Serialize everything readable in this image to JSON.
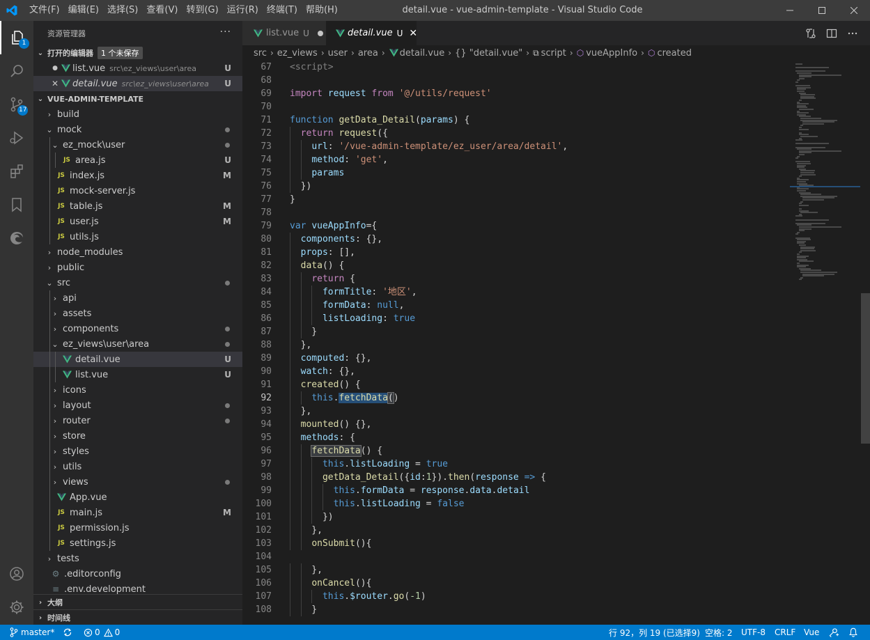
{
  "titlebar": {
    "menus": [
      "文件(F)",
      "编辑(E)",
      "选择(S)",
      "查看(V)",
      "转到(G)",
      "运行(R)",
      "终端(T)",
      "帮助(H)"
    ],
    "title": "detail.vue - vue-admin-template - Visual Studio Code"
  },
  "activity": {
    "explorer_badge": "1",
    "scm_badge": "17"
  },
  "sidebar": {
    "title": "资源管理器",
    "more": "···",
    "open_editors": {
      "label": "打开的编辑器",
      "unsaved_label": "1 个未保存",
      "items": [
        {
          "name": "list.vue",
          "path": "src\\ez_views\\user\\area",
          "status": "U"
        },
        {
          "name": "detail.vue",
          "path": "src\\ez_views\\user\\area",
          "status": "U"
        }
      ]
    },
    "project": {
      "label": "VUE-ADMIN-TEMPLATE",
      "tree": [
        {
          "name": "build",
          "kind": "folder",
          "depth": 0,
          "open": false,
          "status": ""
        },
        {
          "name": "mock",
          "kind": "folder",
          "depth": 0,
          "open": true,
          "status": "dot"
        },
        {
          "name": "ez_mock\\user",
          "kind": "folder",
          "depth": 1,
          "open": true,
          "status": "dot"
        },
        {
          "name": "area.js",
          "kind": "js",
          "depth": 2,
          "status": "U"
        },
        {
          "name": "index.js",
          "kind": "js",
          "depth": 1,
          "status": "M"
        },
        {
          "name": "mock-server.js",
          "kind": "js",
          "depth": 1,
          "status": ""
        },
        {
          "name": "table.js",
          "kind": "js",
          "depth": 1,
          "status": "M"
        },
        {
          "name": "user.js",
          "kind": "js",
          "depth": 1,
          "status": "M"
        },
        {
          "name": "utils.js",
          "kind": "js",
          "depth": 1,
          "status": ""
        },
        {
          "name": "node_modules",
          "kind": "folder",
          "depth": 0,
          "open": false,
          "status": ""
        },
        {
          "name": "public",
          "kind": "folder",
          "depth": 0,
          "open": false,
          "status": ""
        },
        {
          "name": "src",
          "kind": "folder",
          "depth": 0,
          "open": true,
          "status": "dot"
        },
        {
          "name": "api",
          "kind": "folder",
          "depth": 1,
          "open": false,
          "status": ""
        },
        {
          "name": "assets",
          "kind": "folder",
          "depth": 1,
          "open": false,
          "status": ""
        },
        {
          "name": "components",
          "kind": "folder",
          "depth": 1,
          "open": false,
          "status": "dot"
        },
        {
          "name": "ez_views\\user\\area",
          "kind": "folder",
          "depth": 1,
          "open": true,
          "status": "dot"
        },
        {
          "name": "detail.vue",
          "kind": "vue",
          "depth": 2,
          "status": "U",
          "selected": true
        },
        {
          "name": "list.vue",
          "kind": "vue",
          "depth": 2,
          "status": "U"
        },
        {
          "name": "icons",
          "kind": "folder",
          "depth": 1,
          "open": false,
          "status": ""
        },
        {
          "name": "layout",
          "kind": "folder",
          "depth": 1,
          "open": false,
          "status": "dot"
        },
        {
          "name": "router",
          "kind": "folder",
          "depth": 1,
          "open": false,
          "status": "dot"
        },
        {
          "name": "store",
          "kind": "folder",
          "depth": 1,
          "open": false,
          "status": ""
        },
        {
          "name": "styles",
          "kind": "folder",
          "depth": 1,
          "open": false,
          "status": ""
        },
        {
          "name": "utils",
          "kind": "folder",
          "depth": 1,
          "open": false,
          "status": ""
        },
        {
          "name": "views",
          "kind": "folder",
          "depth": 1,
          "open": false,
          "status": "dot"
        },
        {
          "name": "App.vue",
          "kind": "vue",
          "depth": 1,
          "status": ""
        },
        {
          "name": "main.js",
          "kind": "js",
          "depth": 1,
          "status": "M"
        },
        {
          "name": "permission.js",
          "kind": "js",
          "depth": 1,
          "status": ""
        },
        {
          "name": "settings.js",
          "kind": "js",
          "depth": 1,
          "status": ""
        },
        {
          "name": "tests",
          "kind": "folder",
          "depth": 0,
          "open": false,
          "status": ""
        },
        {
          "name": ".editorconfig",
          "kind": "cfg",
          "depth": 0,
          "status": ""
        },
        {
          "name": ".env.development",
          "kind": "txt",
          "depth": 0,
          "status": ""
        }
      ]
    },
    "outline_label": "大纲",
    "timeline_label": "时间线"
  },
  "tabs": [
    {
      "name": "list.vue",
      "status": "U",
      "active": false,
      "dirty": true
    },
    {
      "name": "detail.vue",
      "status": "U",
      "active": true,
      "dirty": false
    }
  ],
  "breadcrumb": [
    "src",
    "ez_views",
    "user",
    "area",
    "detail.vue",
    "{} \"detail.vue\"",
    "script",
    "vueAppInfo",
    "created"
  ],
  "code": {
    "lines": [
      {
        "n": "67",
        "t": [
          [
            "t",
            "<script>"
          ]
        ]
      },
      {
        "n": "68",
        "t": []
      },
      {
        "n": "69",
        "t": [
          [
            "kc",
            "import"
          ],
          [
            "d",
            " "
          ],
          [
            "p",
            "request"
          ],
          [
            "d",
            " "
          ],
          [
            "kc",
            "from"
          ],
          [
            "d",
            " "
          ],
          [
            "s",
            "'@/utils/request'"
          ]
        ]
      },
      {
        "n": "70",
        "t": []
      },
      {
        "n": "71",
        "t": [
          [
            "k",
            "function"
          ],
          [
            "d",
            " "
          ],
          [
            "f",
            "getData_Detail"
          ],
          [
            "d",
            "("
          ],
          [
            "p",
            "params"
          ],
          [
            "d",
            ") {"
          ]
        ]
      },
      {
        "n": "72",
        "t": [
          [
            "d",
            "  "
          ],
          [
            "kc",
            "return"
          ],
          [
            "d",
            " "
          ],
          [
            "f",
            "request"
          ],
          [
            "d",
            "({"
          ]
        ]
      },
      {
        "n": "73",
        "t": [
          [
            "d",
            "    "
          ],
          [
            "p",
            "url"
          ],
          [
            "d",
            ": "
          ],
          [
            "s",
            "'/vue-admin-template/ez_user/area/detail'"
          ],
          [
            "d",
            ","
          ]
        ]
      },
      {
        "n": "74",
        "t": [
          [
            "d",
            "    "
          ],
          [
            "p",
            "method"
          ],
          [
            "d",
            ": "
          ],
          [
            "s",
            "'get'"
          ],
          [
            "d",
            ","
          ]
        ]
      },
      {
        "n": "75",
        "t": [
          [
            "d",
            "    "
          ],
          [
            "p",
            "params"
          ]
        ]
      },
      {
        "n": "76",
        "t": [
          [
            "d",
            "  })"
          ]
        ]
      },
      {
        "n": "77",
        "t": [
          [
            "d",
            "}"
          ]
        ]
      },
      {
        "n": "78",
        "t": []
      },
      {
        "n": "79",
        "t": [
          [
            "k",
            "var"
          ],
          [
            "d",
            " "
          ],
          [
            "p",
            "vueAppInfo"
          ],
          [
            "d",
            "={"
          ]
        ]
      },
      {
        "n": "80",
        "t": [
          [
            "d",
            "  "
          ],
          [
            "p",
            "components"
          ],
          [
            "d",
            ": {},"
          ]
        ]
      },
      {
        "n": "81",
        "t": [
          [
            "d",
            "  "
          ],
          [
            "p",
            "props"
          ],
          [
            "d",
            ": [],"
          ]
        ]
      },
      {
        "n": "82",
        "t": [
          [
            "d",
            "  "
          ],
          [
            "f",
            "data"
          ],
          [
            "d",
            "() {"
          ]
        ]
      },
      {
        "n": "83",
        "t": [
          [
            "d",
            "    "
          ],
          [
            "kc",
            "return"
          ],
          [
            "d",
            " {"
          ]
        ]
      },
      {
        "n": "84",
        "t": [
          [
            "d",
            "      "
          ],
          [
            "p",
            "formTitle"
          ],
          [
            "d",
            ": "
          ],
          [
            "s",
            "'地区'"
          ],
          [
            "d",
            ","
          ]
        ]
      },
      {
        "n": "85",
        "t": [
          [
            "d",
            "      "
          ],
          [
            "p",
            "formData"
          ],
          [
            "d",
            ": "
          ],
          [
            "k",
            "null"
          ],
          [
            "d",
            ","
          ]
        ]
      },
      {
        "n": "86",
        "t": [
          [
            "d",
            "      "
          ],
          [
            "p",
            "listLoading"
          ],
          [
            "d",
            ": "
          ],
          [
            "k",
            "true"
          ]
        ]
      },
      {
        "n": "87",
        "t": [
          [
            "d",
            "    }"
          ]
        ]
      },
      {
        "n": "88",
        "t": [
          [
            "d",
            "  },"
          ]
        ]
      },
      {
        "n": "89",
        "t": [
          [
            "d",
            "  "
          ],
          [
            "p",
            "computed"
          ],
          [
            "d",
            ": {},"
          ]
        ]
      },
      {
        "n": "90",
        "t": [
          [
            "d",
            "  "
          ],
          [
            "p",
            "watch"
          ],
          [
            "d",
            ": {},"
          ]
        ]
      },
      {
        "n": "91",
        "t": [
          [
            "d",
            "  "
          ],
          [
            "f",
            "created"
          ],
          [
            "d",
            "() {"
          ]
        ]
      },
      {
        "n": "92",
        "t": [
          [
            "d",
            "    "
          ],
          [
            "k",
            "this"
          ],
          [
            "d",
            "."
          ],
          [
            "fh",
            "fetchData"
          ],
          [
            "cur",
            ""
          ],
          [
            "bm",
            "("
          ],
          [
            "d",
            ")"
          ]
        ],
        "current": true
      },
      {
        "n": "93",
        "t": [
          [
            "d",
            "  },"
          ]
        ]
      },
      {
        "n": "94",
        "t": [
          [
            "d",
            "  "
          ],
          [
            "f",
            "mounted"
          ],
          [
            "d",
            "() {},"
          ]
        ]
      },
      {
        "n": "95",
        "t": [
          [
            "d",
            "  "
          ],
          [
            "p",
            "methods"
          ],
          [
            "d",
            ": {"
          ]
        ]
      },
      {
        "n": "96",
        "t": [
          [
            "d",
            "    "
          ],
          [
            "fm",
            "fetchData"
          ],
          [
            "d",
            "() {"
          ]
        ]
      },
      {
        "n": "97",
        "t": [
          [
            "d",
            "      "
          ],
          [
            "k",
            "this"
          ],
          [
            "d",
            "."
          ],
          [
            "p",
            "listLoading"
          ],
          [
            "d",
            " = "
          ],
          [
            "k",
            "true"
          ]
        ]
      },
      {
        "n": "98",
        "t": [
          [
            "d",
            "      "
          ],
          [
            "f",
            "getData_Detail"
          ],
          [
            "d",
            "({"
          ],
          [
            "p",
            "id"
          ],
          [
            "d",
            ":"
          ],
          [
            "num",
            "1"
          ],
          [
            "d",
            "})."
          ],
          [
            "f",
            "then"
          ],
          [
            "d",
            "("
          ],
          [
            "p",
            "response"
          ],
          [
            "d",
            " "
          ],
          [
            "k",
            "=>"
          ],
          [
            "d",
            " {"
          ]
        ]
      },
      {
        "n": "99",
        "t": [
          [
            "d",
            "        "
          ],
          [
            "k",
            "this"
          ],
          [
            "d",
            "."
          ],
          [
            "p",
            "formData"
          ],
          [
            "d",
            " = "
          ],
          [
            "p",
            "response"
          ],
          [
            "d",
            "."
          ],
          [
            "p",
            "data"
          ],
          [
            "d",
            "."
          ],
          [
            "p",
            "detail"
          ]
        ]
      },
      {
        "n": "100",
        "t": [
          [
            "d",
            "        "
          ],
          [
            "k",
            "this"
          ],
          [
            "d",
            "."
          ],
          [
            "p",
            "listLoading"
          ],
          [
            "d",
            " = "
          ],
          [
            "k",
            "false"
          ]
        ]
      },
      {
        "n": "101",
        "t": [
          [
            "d",
            "      })"
          ]
        ]
      },
      {
        "n": "102",
        "t": [
          [
            "d",
            "    },"
          ]
        ]
      },
      {
        "n": "103",
        "t": [
          [
            "d",
            "    "
          ],
          [
            "f",
            "onSubmit"
          ],
          [
            "d",
            "(){"
          ]
        ]
      },
      {
        "n": "104",
        "t": []
      },
      {
        "n": "105",
        "t": [
          [
            "d",
            "    },"
          ]
        ]
      },
      {
        "n": "106",
        "t": [
          [
            "d",
            "    "
          ],
          [
            "f",
            "onCancel"
          ],
          [
            "d",
            "(){"
          ]
        ]
      },
      {
        "n": "107",
        "t": [
          [
            "d",
            "      "
          ],
          [
            "k",
            "this"
          ],
          [
            "d",
            "."
          ],
          [
            "p",
            "$router"
          ],
          [
            "d",
            "."
          ],
          [
            "f",
            "go"
          ],
          [
            "d",
            "("
          ],
          [
            "num",
            "-1"
          ],
          [
            "d",
            ")"
          ]
        ]
      },
      {
        "n": "108",
        "t": [
          [
            "d",
            "    }"
          ]
        ]
      }
    ]
  },
  "statusbar": {
    "branch": "master*",
    "errors": "0",
    "warnings": "0",
    "position": "行 92，列 19 (已选择9)",
    "spaces": "空格: 2",
    "encoding": "UTF-8",
    "eol": "CRLF",
    "language": "Vue"
  },
  "colors": {
    "accent": "#007acc",
    "vue": "#41b883",
    "js": "#cbcb41"
  }
}
